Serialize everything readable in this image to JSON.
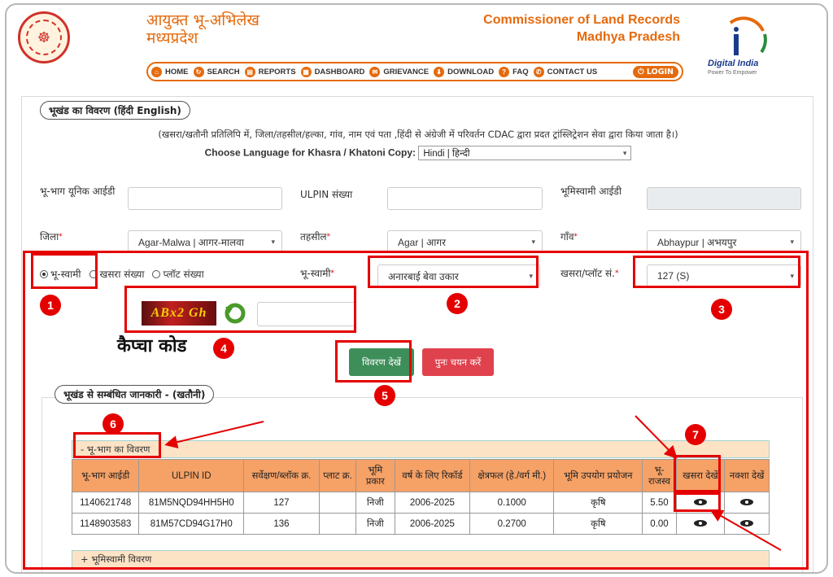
{
  "header": {
    "title_hi_line1": "आयुक्त भू-अभिलेख",
    "title_hi_line2": "मध्यप्रदेश",
    "title_en_line1": "Commissioner of Land Records",
    "title_en_line2": "Madhya Pradesh",
    "digital_india": "Digital India",
    "digital_india_sub": "Power To Empower"
  },
  "nav": {
    "items": [
      {
        "label": "HOME",
        "icon": "home-icon"
      },
      {
        "label": "SEARCH",
        "icon": "refresh-icon"
      },
      {
        "label": "REPORTS",
        "icon": "report-icon"
      },
      {
        "label": "DASHBOARD",
        "icon": "dashboard-icon"
      },
      {
        "label": "GRIEVANCE",
        "icon": "grievance-icon"
      },
      {
        "label": "DOWNLOAD",
        "icon": "download-icon"
      },
      {
        "label": "FAQ",
        "icon": "faq-icon"
      },
      {
        "label": "CONTACT US",
        "icon": "contact-icon"
      }
    ],
    "login": "LOGIN"
  },
  "form": {
    "legend": "भूखंड का विवरण (हिंदी English)",
    "note": "(खसरा/खतौनी प्रतिलिपि में, जिला/तहसील/हल्का, गांव, नाम एवं पता ,हिंदी से अंग्रेजी में परिवर्तन CDAC द्वारा प्रदत ट्रांस्लिट्रेशन सेवा द्वारा किया जाता है।)",
    "lang_label": "Choose Language for Khasra / Khatoni Copy:",
    "lang_value": "Hindi | हिन्दी",
    "unique_id_label": "भू-भाग यूनिक आईडी",
    "ulpin_label": "ULPIN संख्या",
    "owner_id_label": "भूमिस्वामी आईडी",
    "district_label": "जिला",
    "district_value": "Agar-Malwa | आगर-मालवा",
    "tehsil_label": "तहसील",
    "tehsil_value": "Agar | आगर",
    "village_label": "गाँव",
    "village_value": "Abhaypur | अभयपुर",
    "radio_owner": "भू-स्वामी",
    "radio_khasra": "खसरा संख्या",
    "radio_plot": "प्लॉट संख्या",
    "owner_label": "भू-स्वामी",
    "owner_value": "अनारबाई बेवा उकार",
    "khasra_label": "खसरा/प्लॉट सं.",
    "khasra_value": "127 (S)",
    "captcha_text": "ABx2 Gh",
    "captcha_label": "कैप्चा कोड",
    "view_button": "विवरण देखें",
    "reset_button": "पुनः चयन करें"
  },
  "details": {
    "legend": "भूखंड से सम्बंधित जानकारी - (खतौनी)",
    "section1": "- भू-भाग का विवरण",
    "section2": "+ भूमिस्वामी विवरण",
    "columns": [
      "भू-भाग आईडी",
      "ULPIN ID",
      "सर्वेक्षण/ब्लॉक क्र.",
      "प्लाट क्र.",
      "भूमि प्रकार",
      "वर्ष के लिए रिकॉर्ड",
      "क्षेत्रफल (हे./वर्ग मी.)",
      "भूमि उपयोग प्रयोजन",
      "भू-राजस्व",
      "खसरा देखें",
      "नक्शा देखें"
    ],
    "rows": [
      [
        "1140621748",
        "81M5NQD94HH5H0",
        "127",
        "",
        "निजी",
        "2006-2025",
        "0.1000",
        "कृषि",
        "5.50"
      ],
      [
        "1148903583",
        "81M57CD94G17H0",
        "136",
        "",
        "निजी",
        "2006-2025",
        "0.2700",
        "कृषि",
        "0.00"
      ]
    ]
  },
  "annotations": [
    "1",
    "2",
    "3",
    "4",
    "5",
    "6",
    "7"
  ],
  "colors": {
    "accent": "#e56a0d",
    "annotation": "#e50000",
    "table_header": "#f6a166",
    "view_button": "#3e8e5a",
    "reset_button": "#e0424d"
  }
}
